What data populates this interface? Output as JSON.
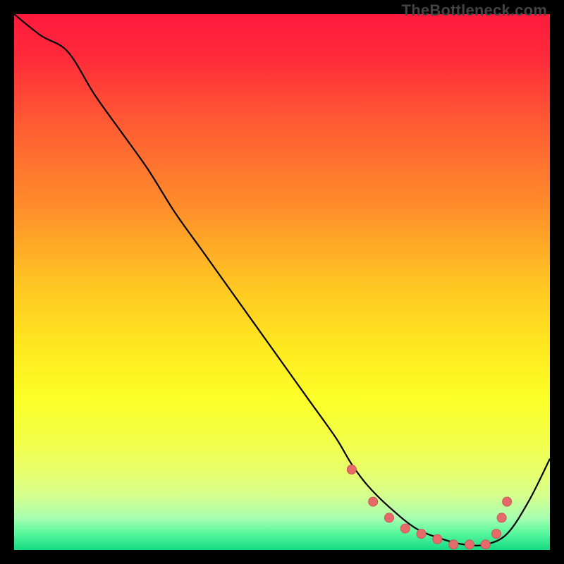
{
  "watermark": "TheBottleneck.com",
  "chart_data": {
    "type": "line",
    "title": "",
    "xlabel": "",
    "ylabel": "",
    "xlim": [
      0,
      100
    ],
    "ylim": [
      0,
      100
    ],
    "series": [
      {
        "name": "curve",
        "x": [
          0,
          5,
          10,
          15,
          20,
          25,
          30,
          35,
          40,
          45,
          50,
          55,
          60,
          63,
          66,
          70,
          75,
          80,
          84,
          88,
          92,
          96,
          100
        ],
        "y": [
          100,
          96,
          93,
          85,
          78,
          71,
          63,
          56,
          49,
          42,
          35,
          28,
          21,
          16,
          12,
          8,
          4,
          2,
          1,
          1,
          3,
          9,
          17
        ]
      }
    ],
    "markers": {
      "x": [
        63,
        67,
        70,
        73,
        76,
        79,
        82,
        85,
        88,
        90,
        91,
        92
      ],
      "y": [
        15,
        9,
        6,
        4,
        3,
        2,
        1,
        1,
        1,
        3,
        6,
        9
      ]
    },
    "gradient_stops": [
      {
        "offset": 0.0,
        "color": "#ff1a3c"
      },
      {
        "offset": 0.08,
        "color": "#ff2a3a"
      },
      {
        "offset": 0.2,
        "color": "#ff5a33"
      },
      {
        "offset": 0.35,
        "color": "#ff8a2b"
      },
      {
        "offset": 0.5,
        "color": "#ffc423"
      },
      {
        "offset": 0.62,
        "color": "#ffe81f"
      },
      {
        "offset": 0.72,
        "color": "#fbff28"
      },
      {
        "offset": 0.8,
        "color": "#f2ff4a"
      },
      {
        "offset": 0.86,
        "color": "#e6ff70"
      },
      {
        "offset": 0.9,
        "color": "#d4ff8e"
      },
      {
        "offset": 0.94,
        "color": "#a8ffb0"
      },
      {
        "offset": 0.97,
        "color": "#55f79d"
      },
      {
        "offset": 1.0,
        "color": "#16d983"
      }
    ],
    "curve_color": "#000000",
    "marker_color": "#e66a6a",
    "marker_stroke": "#cc5555"
  }
}
